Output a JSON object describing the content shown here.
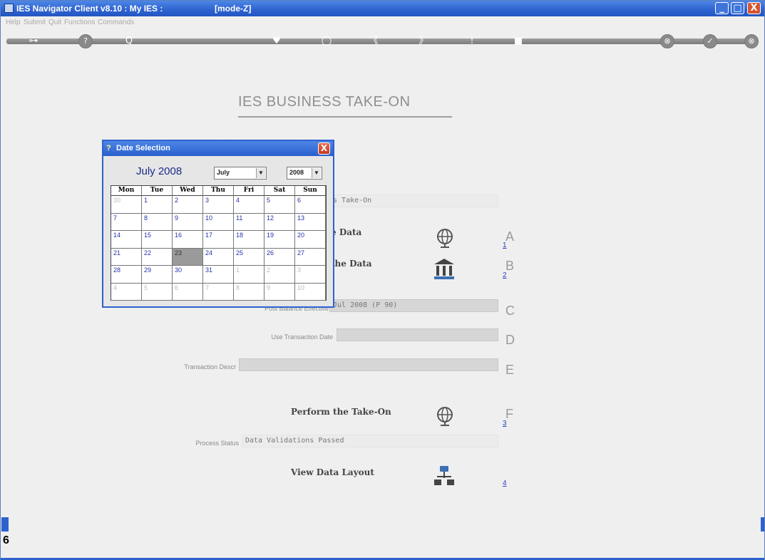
{
  "window": {
    "title": "IES Navigator Client v8.10 : My IES :",
    "mode": "[mode-Z]",
    "min_label": "_",
    "max_label": "□",
    "close_label": "X"
  },
  "menu": [
    "Help",
    "Submit",
    "Quit",
    "Functions",
    "Commands"
  ],
  "toolbar": {
    "icons": [
      "key-icon",
      "help-icon",
      "search-icon",
      "heart-icon",
      "refresh-icon",
      "back-icon",
      "forward-icon",
      "info-icon",
      "bookmark-icon",
      "cancel-icon",
      "ok-icon",
      "close-icon"
    ],
    "glyphs": [
      "⊶",
      "?",
      "Q",
      "♥",
      "◯",
      "《",
      "》",
      "!",
      "■",
      "⊗",
      "✓",
      "⊗"
    ]
  },
  "page": {
    "title": "IES BUSINESS TAKE-ON",
    "take_on_field": "es Take-On",
    "section_a_label": "e Data",
    "section_b_label": "the Data",
    "post_balance_label": "Post Balance Effective",
    "post_balance_value": "Jul 2008 (P 90)",
    "use_txn_date_label": "Use Transaction Date",
    "use_txn_date_value": "",
    "txn_descr_label": "Transaction Descr",
    "txn_descr_value": "",
    "perform_label": "Perform the Take-On",
    "process_status_label": "Process Status",
    "process_status_value": "Data Validations Passed",
    "view_layout_label": "View Data Layout",
    "letters": [
      "A",
      "B",
      "C",
      "D",
      "E",
      "F"
    ],
    "steps": [
      "1",
      "2",
      "3",
      "4"
    ]
  },
  "dialog": {
    "title": "Date Selection",
    "close_label": "X",
    "month_label": "July 2008",
    "month_select": "July",
    "year_select": "2008",
    "weekdays": [
      "Mon",
      "Tue",
      "Wed",
      "Thu",
      "Fri",
      "Sat",
      "Sun"
    ],
    "weeks": [
      [
        "30",
        "1",
        "2",
        "3",
        "4",
        "5",
        "6"
      ],
      [
        "7",
        "8",
        "9",
        "10",
        "11",
        "12",
        "13"
      ],
      [
        "14",
        "15",
        "16",
        "17",
        "18",
        "19",
        "20"
      ],
      [
        "21",
        "22",
        "23",
        "24",
        "25",
        "26",
        "27"
      ],
      [
        "28",
        "29",
        "30",
        "31",
        "1",
        "2",
        "3"
      ],
      [
        "4",
        "5",
        "6",
        "7",
        "8",
        "9",
        "10"
      ]
    ],
    "selected_day": "23"
  },
  "side_left_char": "6",
  "colors": {
    "titlebar": "#2d62cf",
    "link": "#2b3fc4",
    "selected_cell": "#9a9a9a"
  }
}
